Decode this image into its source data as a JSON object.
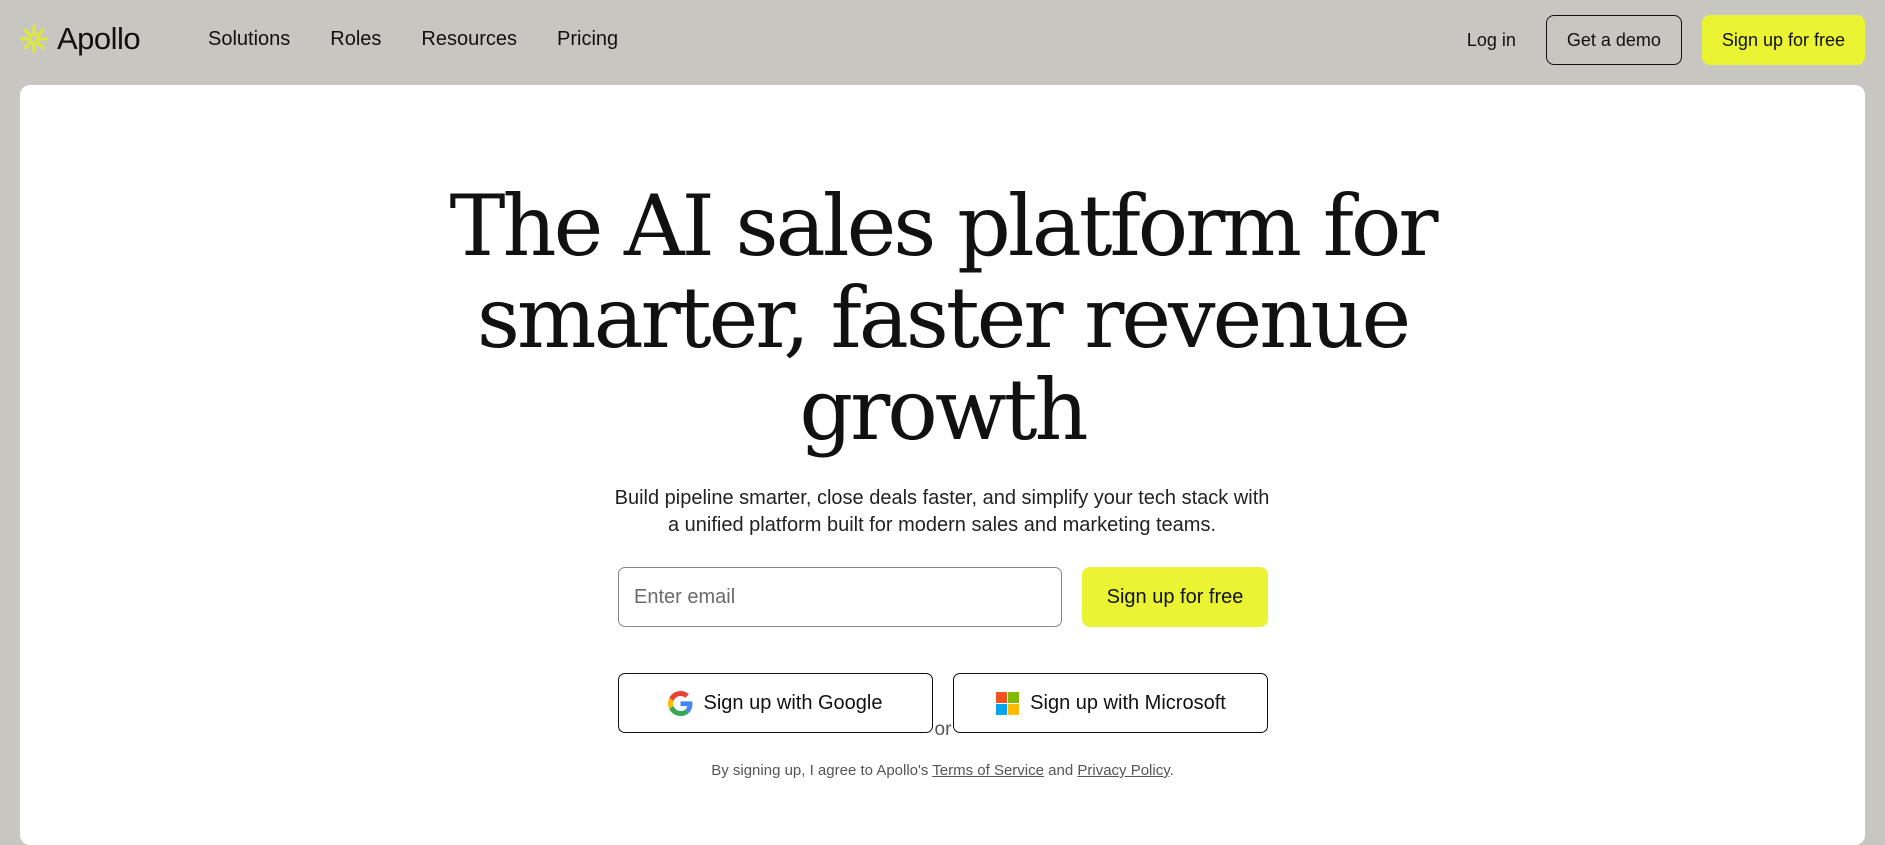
{
  "brand": {
    "name": "Apollo",
    "logo_icon": "apollo-sunburst-icon",
    "accent": "#eaf432"
  },
  "nav": {
    "links": [
      "Solutions",
      "Roles",
      "Resources",
      "Pricing"
    ],
    "login_label": "Log in",
    "demo_label": "Get a demo",
    "signup_label": "Sign up for free"
  },
  "hero": {
    "title_lines": [
      "The AI sales platform for",
      "smarter, faster revenue",
      "growth"
    ],
    "subtitle_line1": "Build pipeline smarter, close deals faster, and simplify your tech stack with",
    "subtitle_line2": "a unified platform built for modern sales and marketing teams."
  },
  "signup": {
    "email_placeholder": "Enter email",
    "email_value": "",
    "submit_label": "Sign up for free",
    "or_label": "or",
    "google_label": "Sign up with Google",
    "microsoft_label": "Sign up with Microsoft"
  },
  "terms": {
    "prefix": "By signing up, I agree to Apollo's ",
    "tos_label": "Terms of Service",
    "middle": " and ",
    "privacy_label": "Privacy Policy",
    "suffix": "."
  },
  "colors": {
    "page_bg": "#c8c6c1",
    "card_bg": "#ffffff",
    "accent_yellow": "#eaf432",
    "text": "#111111"
  }
}
